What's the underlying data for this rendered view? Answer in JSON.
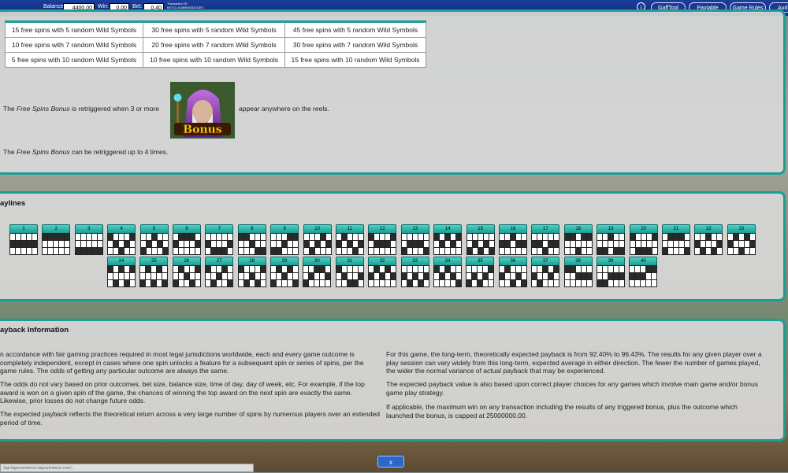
{
  "topbar": {
    "balance_label": "Balance:",
    "balance_value": "4400.00",
    "win_label": "Win:",
    "win_value": "0.00",
    "bet_label": "Bet:",
    "bet_value": "0.40",
    "transaction_label": "Transaction ID",
    "transaction_value": "N0710-1638908332316S7",
    "buttons": [
      "GaffTool",
      "Paytable",
      "Game Rules",
      "Aud"
    ]
  },
  "free_spins_table": {
    "rows": [
      [
        "15 free spins with 5 random Wild Symbols",
        "30 free spins with 5 random Wild Symbols",
        "45 free spins with 5 random Wild Symbols"
      ],
      [
        "10 free spins with 7 random Wild Symbols",
        "20 free spins with 7 random Wild Symbols",
        "30 free spins with 7 random Wild Symbols"
      ],
      [
        "5 free spins with 10 random Wild Symbols",
        "10 free spins with 10 random Wild Symbols",
        "15 free spins with 10 random Wild Symbols"
      ]
    ]
  },
  "retrigger": {
    "line1_prefix": "The ",
    "line1_italic": "Free Spins Bonus",
    "line1_mid": " is retriggered when 3 or more",
    "line1_suffix": "appear anywhere on the reels.",
    "bonus_symbol_text": "Bonus",
    "line2_prefix": "The ",
    "line2_italic": "Free Spins Bonus",
    "line2_suffix": " can be retriggered up to 4 times."
  },
  "paylines": {
    "title": "aylines",
    "numbers": [
      "1",
      "2",
      "3",
      "4",
      "5",
      "6",
      "7",
      "8",
      "9",
      "10",
      "11",
      "12",
      "13",
      "14",
      "15",
      "16",
      "17",
      "18",
      "19",
      "20",
      "21",
      "22",
      "23",
      "24",
      "25",
      "26",
      "27",
      "28",
      "29",
      "30",
      "31",
      "32",
      "33",
      "34",
      "35",
      "36",
      "37",
      "38",
      "39",
      "40"
    ],
    "patterns": [
      [
        1,
        1,
        1,
        1,
        1
      ],
      [
        0,
        0,
        0,
        0,
        0
      ],
      [
        2,
        2,
        2,
        2,
        2
      ],
      [
        0,
        1,
        2,
        1,
        0
      ],
      [
        2,
        1,
        0,
        1,
        2
      ],
      [
        1,
        0,
        0,
        0,
        1
      ],
      [
        1,
        2,
        2,
        2,
        1
      ],
      [
        0,
        0,
        1,
        2,
        2
      ],
      [
        2,
        2,
        1,
        0,
        0
      ],
      [
        1,
        2,
        1,
        0,
        1
      ],
      [
        1,
        0,
        1,
        2,
        1
      ],
      [
        0,
        1,
        1,
        1,
        0
      ],
      [
        2,
        1,
        1,
        1,
        2
      ],
      [
        0,
        1,
        0,
        1,
        0
      ],
      [
        2,
        1,
        2,
        1,
        2
      ],
      [
        1,
        1,
        0,
        1,
        1
      ],
      [
        1,
        1,
        2,
        1,
        1
      ],
      [
        0,
        0,
        2,
        0,
        0
      ],
      [
        2,
        2,
        0,
        2,
        2
      ],
      [
        0,
        2,
        2,
        2,
        0
      ],
      [
        2,
        0,
        0,
        0,
        2
      ],
      [
        1,
        2,
        0,
        2,
        1
      ],
      [
        1,
        0,
        2,
        0,
        1
      ],
      [
        0,
        2,
        0,
        2,
        0
      ],
      [
        2,
        0,
        2,
        0,
        2
      ],
      [
        2,
        0,
        1,
        2,
        0
      ],
      [
        0,
        2,
        1,
        0,
        2
      ],
      [
        0,
        2,
        1,
        2,
        0
      ],
      [
        2,
        0,
        1,
        0,
        2
      ],
      [
        2,
        1,
        0,
        0,
        1
      ],
      [
        0,
        1,
        2,
        2,
        1
      ],
      [
        1,
        0,
        1,
        0,
        1
      ],
      [
        1,
        2,
        1,
        2,
        1
      ],
      [
        0,
        1,
        0,
        1,
        2
      ],
      [
        2,
        1,
        2,
        1,
        0
      ],
      [
        1,
        0,
        2,
        1,
        2
      ],
      [
        1,
        2,
        0,
        1,
        0
      ],
      [
        0,
        0,
        1,
        1,
        1
      ],
      [
        2,
        2,
        1,
        1,
        1
      ],
      [
        1,
        1,
        1,
        0,
        0
      ]
    ]
  },
  "payback": {
    "title": "ayback Information",
    "left": [
      "n accordance with fair gaming practices required in most legal jurisdictions worldwide, each and every game outcome is completely independent, except in cases where one spin unlocks a feature for a subsequent spin or series of spins, per the game rules. The odds of getting any particular outcome are always the same.",
      "The odds do not vary based on prior outcomes, bet size, balance size, time of day, day of week, etc. For example, if the top award is won on a given spin of the game, the chances of winning the top award on the next spin are exactly the same. Likewise, prior losses do not change future odds.",
      "The expected payback reflects the theoretical return across a very large number of spins by numerous players over an extended period of time."
    ],
    "right": [
      "For this game, the long-term, theoretically expected payback is from 92.40% to 96.43%. The results for any given player over a play session can vary widely from this long-term, expected average in either direction. The fewer the number of games played, the wider the normal variance of actual payback that may be experienced.",
      "The expected payback value is also based upon correct player choices for any games which involve main game and/or bonus game play strategy.",
      "If applicable, the maximum win on any transaction including the results of any triggered bonus, plus the outcome which launched the bonus, is capped at 25000000.00."
    ]
  },
  "close_button": "x",
  "status_url": "//qa-bigcommerce1.bigcommerce.com/..."
}
